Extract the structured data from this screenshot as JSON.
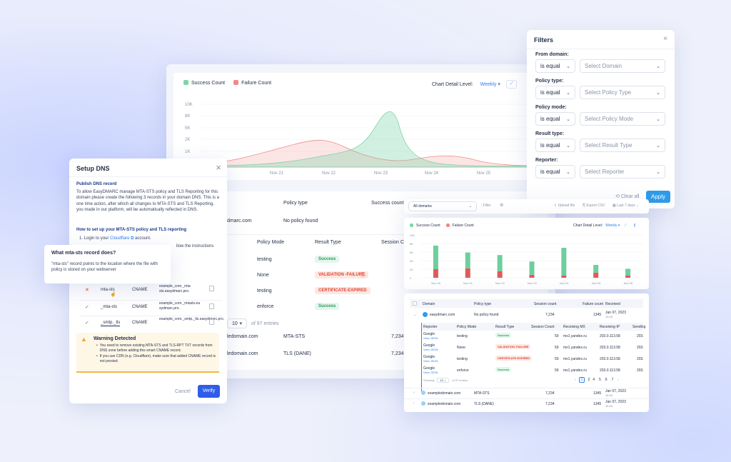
{
  "main_chart": {
    "legend": {
      "success": "Success Count",
      "failure": "Failure Count"
    },
    "detail_label": "Chart Detail Level:",
    "detail_value": "Weekly",
    "y_ticks": [
      "10K",
      "8K",
      "5K",
      "2K",
      "1K"
    ],
    "x_ticks": [
      "Nov 21",
      "Nov 22",
      "Nov 23",
      "Nov 24",
      "Nov 25"
    ]
  },
  "main_table": {
    "headers": {
      "policy_type": "Policy type",
      "success_count": "Success count"
    },
    "row1": {
      "domain": "dmarc.com",
      "policy": "No policy found"
    },
    "sub_headers": {
      "policy_mode": "Policy Mode",
      "result_type": "Result Type",
      "session": "Session Co"
    },
    "sub_rows": [
      {
        "mode": "testing",
        "result": "Success"
      },
      {
        "mode": "None",
        "result": "VALIDATION -FAILURE"
      },
      {
        "mode": "testing",
        "result": "CERTIFICATE-EXPIRED"
      },
      {
        "mode": "enforce",
        "result": "Success"
      }
    ],
    "pagination": {
      "size": "10",
      "entries": "of 97 entries"
    },
    "rows": [
      {
        "domain": "ledomain.com",
        "policy": "MTA-STS",
        "count": "7,234"
      },
      {
        "domain": "ledomain.com",
        "policy": "TLS (DANE)",
        "count": "7,234"
      }
    ]
  },
  "filters": {
    "title": "Filters",
    "fields": [
      {
        "label": "From domain:",
        "op": "is equal",
        "placeholder": "Select Domain"
      },
      {
        "label": "Policy type:",
        "op": "is equal",
        "placeholder": "Select Policy Type"
      },
      {
        "label": "Policy mode:",
        "op": "is equal",
        "placeholder": "Select Policy Mode"
      },
      {
        "label": "Result type:",
        "op": "is equal",
        "placeholder": "Select Result Type"
      },
      {
        "label": "Reporter:",
        "op": "is equal",
        "placeholder": "Select Reporter"
      }
    ],
    "clear": "Clear all",
    "apply": "Apply"
  },
  "setup": {
    "title": "Setup DNS",
    "publish_heading": "Publish DNS record",
    "intro": "To allow EasyDMARC manage MTA-STS policy and TLS Reporting for this domain please create the following 3 records in your domain DNS. This is a one time action, after which all changes to MTA-STS and TLS Reporting, you made in our platform, will be automatically reflected in DNS.",
    "howto_heading": "How to set up your MTA-STS policy and TLS reporting",
    "step1_prefix": "1. Login to your ",
    "step1_link": "Cloudflare",
    "step1_suffix": " account.",
    "step2_tail": "llow the instructions",
    "records": [
      {
        "status": "✕",
        "name": "mta-sts",
        "type": "CNAME",
        "value": "example_com._mta sts.easydmarc.pro."
      },
      {
        "status": "✓",
        "name": "_mta-sts",
        "type": "CNAME",
        "value": "example_com._mtasts.ea sydmarc.pro."
      },
      {
        "status": "✓",
        "name": "_smtp._tls",
        "type": "CNAME",
        "value": "example_com._smtp._tls.easydmarc.pro."
      }
    ],
    "warning_title": "Warning Detected",
    "warning_items": [
      "You need to remove existing MTA-STS and TLS-RPT TXT records from DNS zone before adding this smart CNAME record.",
      "If you use CDN (e.g. Cloudflare), make sure that added CNAME record is not proxied."
    ],
    "cancel": "Cancel",
    "verify": "Verify"
  },
  "tooltip": {
    "title": "What mta-sts record does?",
    "body": "\"mta-sts\" record points to the location where the file with policy is stored on your webserver"
  },
  "toolbar": {
    "domains": "All domains",
    "filter": "Filter",
    "upload": "Upload file",
    "export": "Export CSV",
    "range": "Last 7 days"
  },
  "mini_chart": {
    "legend": {
      "success": "Success Count",
      "failure": "Failure Count"
    },
    "detail_label": "Chart Detail Level:",
    "detail_value": "Weekly",
    "y_ticks": [
      "10K",
      "8K",
      "6K",
      "4K",
      "2K",
      "0"
    ],
    "chart_data": {
      "type": "bar",
      "categories": [
        "Nov 20",
        "Nov 21",
        "Nov 22",
        "Nov 23",
        "Nov 24",
        "Nov 25",
        "Nov 26"
      ],
      "series": [
        {
          "name": "Success Count",
          "values": [
            5500,
            3700,
            3800,
            3100,
            6500,
            1800,
            1600
          ]
        },
        {
          "name": "Failure Count",
          "values": [
            2000,
            2200,
            1500,
            700,
            500,
            1200,
            500
          ]
        }
      ],
      "ylim": [
        0,
        10000
      ]
    }
  },
  "mini_table": {
    "headers": [
      "Domain",
      "Policy type",
      "Session count",
      "Failure count",
      "Received"
    ],
    "top_row": {
      "domain": "easydmarc.com",
      "policy": "No policy found",
      "count": "7,234",
      "failures": "1345",
      "received": "Jan 07, 2023",
      "time": "16:45"
    },
    "sub_headers": [
      "Reporter",
      "Policy Mode",
      "Result Type",
      "Session Count",
      "Receiving MX",
      "Receiving IP",
      "Sending"
    ],
    "sub_rows": [
      {
        "reporter": "Google",
        "link": "View JSON",
        "mode": "testing",
        "result": "Success",
        "count": "59",
        "mx": "mx1.yandex.ru",
        "ip": "203.0.113.58",
        "send": "203."
      },
      {
        "reporter": "Google",
        "link": "View JSON",
        "mode": "None",
        "result": "VALIDATION -FAILURE",
        "count": "59",
        "mx": "mx1.yandex.ru",
        "ip": "203.0.113.58",
        "send": "203."
      },
      {
        "reporter": "Google",
        "link": "View JSON",
        "mode": "testing",
        "result": "CERTIFICATE-EXPIRED",
        "count": "59",
        "mx": "mx1.yandex.ru",
        "ip": "203.0.113.58",
        "send": "203."
      },
      {
        "reporter": "Google",
        "link": "View JSON",
        "mode": "enforce",
        "result": "Success",
        "count": "59",
        "mx": "mx1.yandex.ru",
        "ip": "203.0.113.58",
        "send": "203."
      }
    ],
    "showing": "Showing",
    "page_size": "10",
    "entries": "of 97 entries",
    "pages": [
      "1",
      "2",
      "4",
      "5",
      "6",
      "7"
    ],
    "rows": [
      {
        "domain": "exampledomain.com",
        "policy": "MTA-STS",
        "count": "7,234",
        "failures": "1345",
        "received": "Jan 07, 2023",
        "time": "16:45"
      },
      {
        "domain": "exampledomain.com",
        "policy": "TLS (DANE)",
        "count": "7,234",
        "failures": "1345",
        "received": "Jan 07, 2023",
        "time": "16:45"
      }
    ]
  }
}
